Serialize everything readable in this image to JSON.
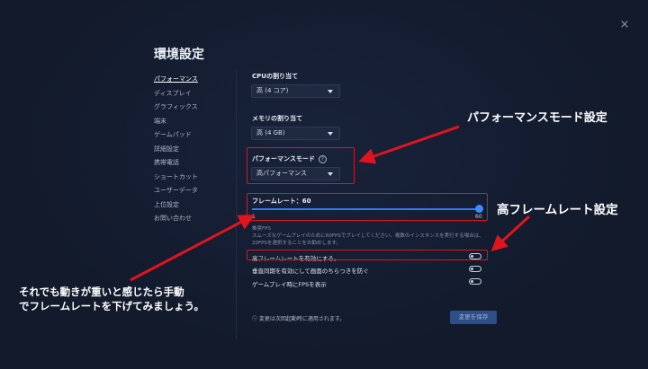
{
  "dialog": {
    "title": "環境設定",
    "close_symbol": "×"
  },
  "sidebar": {
    "items": [
      {
        "label": "パフォーマンス",
        "active": true
      },
      {
        "label": "ディスプレイ"
      },
      {
        "label": "グラフィックス"
      },
      {
        "label": "端末"
      },
      {
        "label": "ゲームパッド"
      },
      {
        "label": "詳細設定"
      },
      {
        "label": "携帯電話"
      },
      {
        "label": "ショートカット"
      },
      {
        "label": "ユーザーデータ"
      },
      {
        "label": "上位設定"
      },
      {
        "label": "お問い合わせ"
      }
    ]
  },
  "performance": {
    "cpu": {
      "label": "CPUの割り当て",
      "value": "高 (4 コア)"
    },
    "memory": {
      "label": "メモリの割り当て",
      "value": "高 (4 GB)"
    },
    "mode": {
      "label": "パフォーマンスモード",
      "value": "高パフォーマンス",
      "help_icon": "?"
    },
    "framerate": {
      "label": "フレームレート：60",
      "min": "1",
      "max": "60",
      "value": 60
    },
    "recommended": {
      "title": "推奨FPS",
      "text": "スムーズなゲームプレイのために60FPSでプレイしてください。複数のインスタンスを実行する場合は、20FPSを選択することをお勧めします。"
    },
    "toggles": [
      {
        "label": "高フレームレートを有効にする。",
        "on": false
      },
      {
        "label": "垂直同期を有効にして画面のちらつきを防ぐ",
        "on": false
      },
      {
        "label": "ゲームプレイ時にFPSを表示",
        "on": false
      }
    ],
    "notice": "ⓘ 変更は次回起動時に適用されます。",
    "save_label": "変更を保存"
  },
  "annotations": {
    "mode_caption": "パフォーマンスモード設定",
    "highfps_caption": "高フレームレート設定",
    "hint_line1": "それでも動きが重いと感じたら手動",
    "hint_line2": "でフレームレートを下げてみましょう。"
  },
  "colors": {
    "accent": "#2f7cf6",
    "annotation_red": "#e0141e",
    "background": "#141c2e"
  }
}
